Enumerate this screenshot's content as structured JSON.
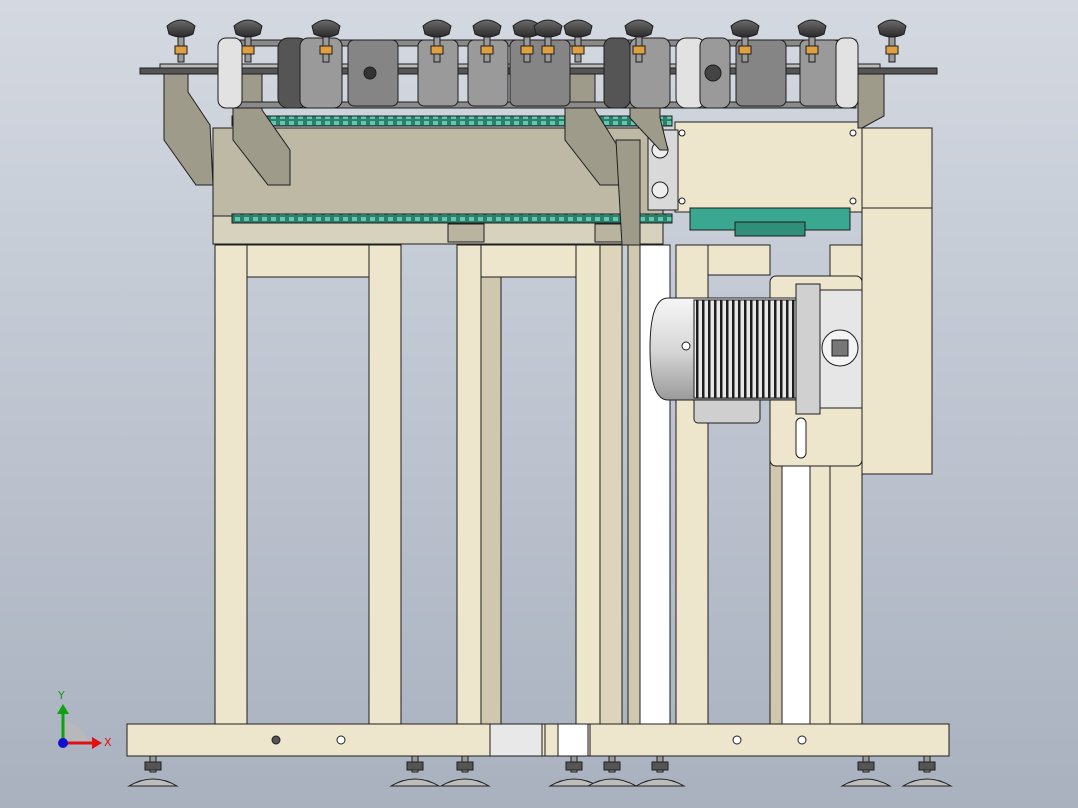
{
  "triad": {
    "x_label": "X",
    "y_label": "Y",
    "x_color": "#e01010",
    "y_color": "#10a010",
    "z_color": "#1010d0"
  },
  "colors": {
    "background_top": "#d4d9e1",
    "background_bottom": "#a9b1bf",
    "frame_cream": "#ede5cc",
    "frame_shadow": "#cfc7ae",
    "machine_gray": "#9e9b8a",
    "motor_silver": "#e4e4e4",
    "belt_green": "#3aa890"
  },
  "scene": {
    "subject": "conveyor-machine-cad-model"
  }
}
